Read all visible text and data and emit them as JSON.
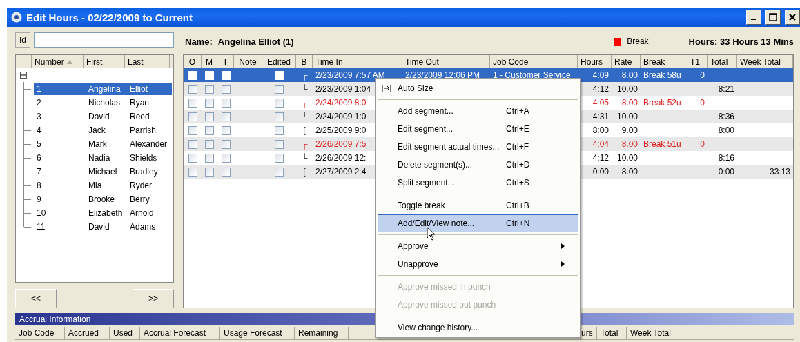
{
  "window": {
    "title": "Edit Hours - 02/22/2009 to Current"
  },
  "employees": {
    "id_label": "Id",
    "columns": [
      "Number",
      "First",
      "Last"
    ],
    "tree": {
      "expanded": true,
      "children": [
        {
          "number": "1",
          "first": "Angelina",
          "last": "Elliot",
          "selected": true
        },
        {
          "number": "2",
          "first": "Nicholas",
          "last": "Ryan",
          "selected": false
        },
        {
          "number": "3",
          "first": "David",
          "last": "Reed",
          "selected": false
        },
        {
          "number": "4",
          "first": "Jack",
          "last": "Parrish",
          "selected": false
        },
        {
          "number": "5",
          "first": "Mark",
          "last": "Alexander",
          "selected": false
        },
        {
          "number": "6",
          "first": "Nadia",
          "last": "Shields",
          "selected": false
        },
        {
          "number": "7",
          "first": "Michael",
          "last": "Bradley",
          "selected": false
        },
        {
          "number": "8",
          "first": "Mia",
          "last": "Ryder",
          "selected": false
        },
        {
          "number": "9",
          "first": "Brooke",
          "last": "Berry",
          "selected": false
        },
        {
          "number": "10",
          "first": "Elizabeth",
          "last": "Arnold",
          "selected": false
        },
        {
          "number": "11",
          "first": "David",
          "last": "Adams",
          "selected": false
        }
      ]
    },
    "buttons": [
      "<<",
      ">>"
    ]
  },
  "timesheet": {
    "name_label": "Name:",
    "name": "Angelina Elliot (1)",
    "legend": "Break",
    "hours_summary": "Hours: 33 Hours 13 Mins",
    "columns": [
      "O",
      "M",
      "I",
      "Note",
      "Edited",
      "B",
      "Time In",
      "Time Out",
      "Job Code",
      "Hours",
      "Rate",
      "Break",
      "T1",
      "Total",
      "Week Total"
    ],
    "rows": [
      {
        "selected": true,
        "on_break": true,
        "o": false,
        "m": false,
        "i": false,
        "edited": false,
        "bracket": "┌",
        "time_in": "2/23/2009 7:57 AM",
        "time_out": "2/23/2009 12:06 PM",
        "job_code": "1 - Customer Service",
        "hours": "4:09",
        "rate": "8.00",
        "break": "Break 58u",
        "t1": "0"
      },
      {
        "selected": false,
        "on_break": false,
        "o": false,
        "m": false,
        "i": false,
        "edited": false,
        "bracket": "└",
        "time_in": "2/23/2009 1:04",
        "hours": "4:12",
        "rate": "10.00",
        "total": "8:21"
      },
      {
        "selected": false,
        "on_break": true,
        "o": false,
        "m": false,
        "i": false,
        "edited": false,
        "bracket": "┌",
        "time_in": "2/24/2009 8:0",
        "hours": "4:05",
        "rate": "8.00",
        "break": "Break 52u",
        "t1": "0"
      },
      {
        "selected": false,
        "on_break": false,
        "o": false,
        "m": false,
        "i": false,
        "edited": false,
        "bracket": "└",
        "time_in": "2/24/2009 1:0",
        "hours": "4:31",
        "rate": "10.00",
        "total": "8:36"
      },
      {
        "selected": false,
        "on_break": false,
        "o": false,
        "m": false,
        "i": false,
        "edited": false,
        "bracket": "[",
        "time_in": "2/25/2009 9:0",
        "hours": "8:00",
        "rate": "9.00",
        "total": "8:00"
      },
      {
        "selected": false,
        "on_break": true,
        "o": false,
        "m": false,
        "i": false,
        "edited": false,
        "bracket": "┌",
        "time_in": "2/26/2009 7:5",
        "hours": "4:04",
        "rate": "8.00",
        "break": "Break 51u",
        "t1": "0"
      },
      {
        "selected": false,
        "on_break": false,
        "o": false,
        "m": false,
        "i": false,
        "edited": false,
        "bracket": "└",
        "time_in": "2/26/2009 12:",
        "hours": "4:12",
        "rate": "10.00",
        "total": "8:16"
      },
      {
        "selected": false,
        "on_break": false,
        "o": false,
        "m": false,
        "i": false,
        "edited": false,
        "bracket": "[",
        "time_in": "2/27/2009 2:4",
        "hours": "0:00",
        "rate": "8.00",
        "total": "0:00",
        "week_total": "33:13"
      }
    ]
  },
  "accrual": {
    "title": "Accrual Information",
    "columns": [
      "Job Code",
      "Accrued",
      "Used",
      "Accrual Forecast",
      "Usage Forecast",
      "Remaining"
    ],
    "columns_right": [
      "urs",
      "Total",
      "Week Total"
    ]
  },
  "context_menu": [
    {
      "kind": "fit_item",
      "label": "Auto Size",
      "disabled": false,
      "selected": false
    },
    {
      "kind": "separator"
    },
    {
      "kind": "item",
      "label": "Add segment...",
      "shortcut": "Ctrl+A",
      "disabled": false,
      "selected": false
    },
    {
      "kind": "item",
      "label": "Edit segment...",
      "shortcut": "Ctrl+E",
      "disabled": false,
      "selected": false
    },
    {
      "kind": "item",
      "label": "Edit segment actual times...",
      "shortcut": "Ctrl+F",
      "disabled": false,
      "selected": false
    },
    {
      "kind": "item",
      "label": "Delete segment(s)...",
      "shortcut": "Ctrl+D",
      "disabled": false,
      "selected": false
    },
    {
      "kind": "item",
      "label": "Split segment...",
      "shortcut": "Ctrl+S",
      "disabled": false,
      "selected": false
    },
    {
      "kind": "separator"
    },
    {
      "kind": "item",
      "label": "Toggle break",
      "shortcut": "Ctrl+B",
      "disabled": false,
      "selected": false
    },
    {
      "kind": "item",
      "label": "Add/Edit/View note...",
      "shortcut": "Ctrl+N",
      "disabled": false,
      "selected": true
    },
    {
      "kind": "separator"
    },
    {
      "kind": "submenu",
      "label": "Approve",
      "disabled": false,
      "selected": false
    },
    {
      "kind": "submenu",
      "label": "Unapprove",
      "disabled": false,
      "selected": false
    },
    {
      "kind": "separator"
    },
    {
      "kind": "item",
      "label": "Approve missed in punch",
      "disabled": true,
      "selected": false
    },
    {
      "kind": "item",
      "label": "Approve missed out punch",
      "disabled": true,
      "selected": false
    },
    {
      "kind": "separator"
    },
    {
      "kind": "item",
      "label": "View change history...",
      "disabled": false,
      "selected": false
    }
  ]
}
